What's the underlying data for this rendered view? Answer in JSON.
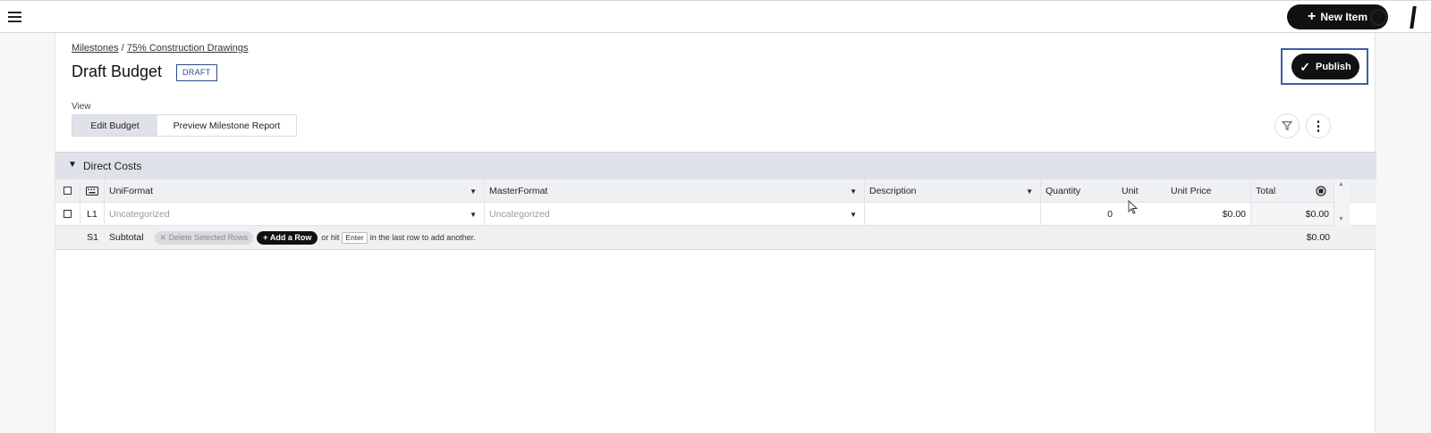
{
  "topbar": {
    "new_item_label": "New Item",
    "help_glyph": "?"
  },
  "breadcrumb": {
    "milestones": "Milestones",
    "separator": "/",
    "current": "75% Construction Drawings"
  },
  "page": {
    "title": "Draft Budget",
    "badge": "DRAFT",
    "publish_label": "Publish"
  },
  "view": {
    "label": "View",
    "tabs": [
      {
        "label": "Edit Budget",
        "active": true
      },
      {
        "label": "Preview Milestone Report",
        "active": false
      }
    ]
  },
  "section": {
    "label": "Direct Costs"
  },
  "table": {
    "headers": {
      "uniformat": "UniFormat",
      "masterformat": "MasterFormat",
      "description": "Description",
      "quantity": "Quantity",
      "unit": "Unit",
      "unit_price": "Unit Price",
      "total": "Total"
    },
    "rows": [
      {
        "id": "L1",
        "uniformat": "Uncategorized",
        "masterformat": "Uncategorized",
        "description": "",
        "quantity": "0",
        "unit": "",
        "unit_price": "$0.00",
        "total": "$0.00"
      }
    ],
    "subtotal": {
      "id": "S1",
      "label": "Subtotal",
      "delete_label": "Delete Selected Rows",
      "add_row_label": "Add a Row",
      "hint_prefix": "or hit",
      "hint_key": "Enter",
      "hint_suffix": "in the last row to add another.",
      "total": "$0.00"
    }
  }
}
